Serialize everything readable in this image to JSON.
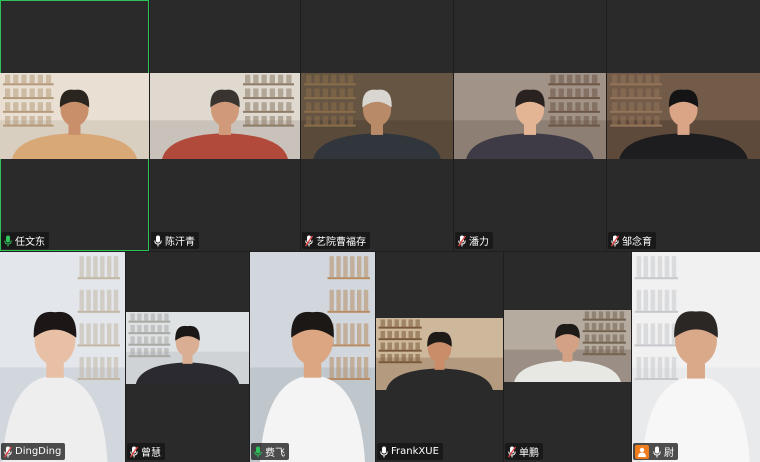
{
  "participants": [
    {
      "name": "任文东",
      "mic": "active",
      "colors": {
        "bg": "#d9cfc0",
        "wall": "#efe7dc",
        "shelf": "#b49a7a",
        "skin": "#c98f6b",
        "shirt": "#d8a877",
        "hair": "#2b2520"
      }
    },
    {
      "name": "陈汗青",
      "mic": "normal",
      "colors": {
        "bg": "#c9c2ba",
        "wall": "#e8e2da",
        "shelf": "#8d7b68",
        "skin": "#d09a7a",
        "shirt": "#b24a3c",
        "hair": "#3a3431"
      }
    },
    {
      "name": "艺院曹福存",
      "mic": "muted",
      "colors": {
        "bg": "#5a4a3a",
        "wall": "#6b5a46",
        "shelf": "#8a6e4c",
        "skin": "#b88a68",
        "shirt": "#31363d",
        "hair": "#d9d6d2"
      }
    },
    {
      "name": "潘力",
      "mic": "muted",
      "colors": {
        "bg": "#8e7f74",
        "wall": "#a99b90",
        "shelf": "#6e5646",
        "skin": "#e3b594",
        "shirt": "#3f3b46",
        "hair": "#2a2220"
      }
    },
    {
      "name": "邹念育",
      "mic": "muted",
      "colors": {
        "bg": "#5e4a3b",
        "wall": "#7b6350",
        "shelf": "#93755a",
        "skin": "#d9a586",
        "shirt": "#1d1d1f",
        "hair": "#151414"
      }
    },
    {
      "name": "DingDing",
      "mic": "muted",
      "colors": {
        "bg": "#d2d7dd",
        "wall": "#e9edf1",
        "shelf": "#c2b6a4",
        "skin": "#e8c0a6",
        "shirt": "#eeeeee",
        "hair": "#1c1716"
      }
    },
    {
      "name": "曾慧",
      "mic": "muted",
      "colors": {
        "bg": "#cfd3d6",
        "wall": "#e6e8ea",
        "shelf": "#a7a7a4",
        "skin": "#d9ae92",
        "shirt": "#2b2a30",
        "hair": "#1a1716"
      }
    },
    {
      "name": "费飞",
      "mic": "active",
      "colors": {
        "bg": "#bfc7cc",
        "wall": "#d8dee2",
        "shelf": "#b88c63",
        "skin": "#dca683",
        "shirt": "#f4f4f4",
        "hair": "#1b1816"
      }
    },
    {
      "name": "FrankXUE",
      "mic": "normal",
      "colors": {
        "bg": "#b49b7f",
        "wall": "#d8c4a8",
        "shelf": "#7a5a3a",
        "skin": "#c98d6a",
        "shirt": "#2a2a2a",
        "hair": "#1d1a18"
      }
    },
    {
      "name": "单鹏",
      "mic": "muted",
      "colors": {
        "bg": "#9b8f85",
        "wall": "#c2b6aa",
        "shelf": "#73634f",
        "skin": "#d3a284",
        "shirt": "#e7e7e4",
        "hair": "#1e1a18"
      }
    },
    {
      "name": "尉",
      "mic": "normal",
      "presenter": true,
      "colors": {
        "bg": "#e9eaec",
        "wall": "#f4f4f5",
        "shelf": "#c6c8cc",
        "skin": "#d9a98a",
        "shirt": "#f7f7f7",
        "hair": "#2a2725"
      }
    }
  ],
  "colors": {
    "active_border": "#2fc25b",
    "mic_active": "#2fc25b",
    "mic_muted": "#e04646",
    "presenter": "#f07c1c"
  }
}
